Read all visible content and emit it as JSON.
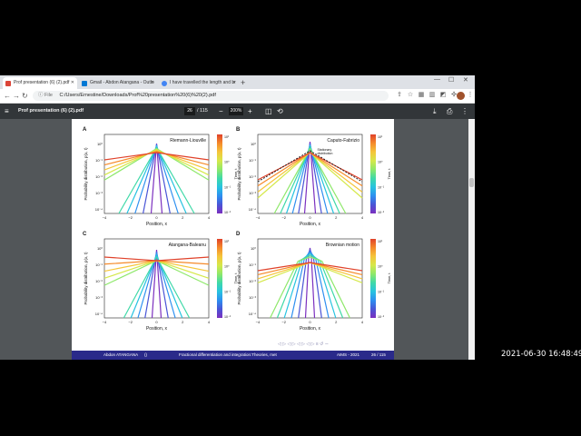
{
  "browser": {
    "tabs": [
      {
        "label": "Prof presentation (6) (2).pdf",
        "active": true,
        "icon": "pdf-icon",
        "icon_color": "#db4437"
      },
      {
        "label": "Gmail - Abdon Atangana - Outlo",
        "active": false,
        "icon": "outlook-icon",
        "icon_color": "#0078d4"
      },
      {
        "label": "I have travelled the length and br",
        "active": false,
        "icon": "google-icon",
        "icon_color": "#4285f4"
      }
    ],
    "new_tab": "+",
    "address": {
      "scheme_label": "File",
      "path": "C:/Users/Ernestine/Downloads/Prof%20presentation%20(6)%20(2).pdf"
    }
  },
  "pdf_toolbar": {
    "title": "Prof presentation (6) (2).pdf",
    "current_page": "26",
    "total_pages": "/ 115",
    "zoom": "200%",
    "zoom_out": "−",
    "zoom_in": "+"
  },
  "figure": {
    "panels": [
      {
        "letter": "A",
        "title": "Riemann-Liouville"
      },
      {
        "letter": "B",
        "title": "Caputo-Fabrizio",
        "legend_line1": "Stationary",
        "legend_line2": "distribution"
      },
      {
        "letter": "C",
        "title": "Atangana-Baleanu"
      },
      {
        "letter": "D",
        "title": "Brownian motion"
      }
    ],
    "ylabel": "Probability distribution, p(x, t)",
    "xlabel": "Position, x",
    "colorbar_label": "Time, t",
    "colorbar_ticks": [
      "10¹",
      "10⁰",
      "10⁻¹",
      "10⁻²"
    ],
    "x_ticks": [
      "−4",
      "−2",
      "0",
      "2",
      "4"
    ],
    "y_ticks_top": [
      "10⁰",
      "10⁻¹",
      "10⁻²",
      "10⁻³",
      "10⁻⁴"
    ],
    "y_ticks_bottom": [
      "10⁰",
      "10⁻¹",
      "10⁻²",
      "10⁻³",
      "10⁻⁴"
    ],
    "curve_colors": [
      "#7b2fbf",
      "#4a55d6",
      "#2d8ff0",
      "#27c3e0",
      "#3fd9a8",
      "#8ee86a",
      "#d5e84a",
      "#f5c53a",
      "#f58a2a",
      "#e0422a"
    ]
  },
  "slide_footer": {
    "author": "Abdon ATANGANA",
    "author_extra": "()",
    "title": "Fractional differentiation and integration:Theories, met",
    "event": "AIMS - 2021",
    "page": "26 / 115"
  },
  "timestamp": "2021-06-30 16:48:49"
}
